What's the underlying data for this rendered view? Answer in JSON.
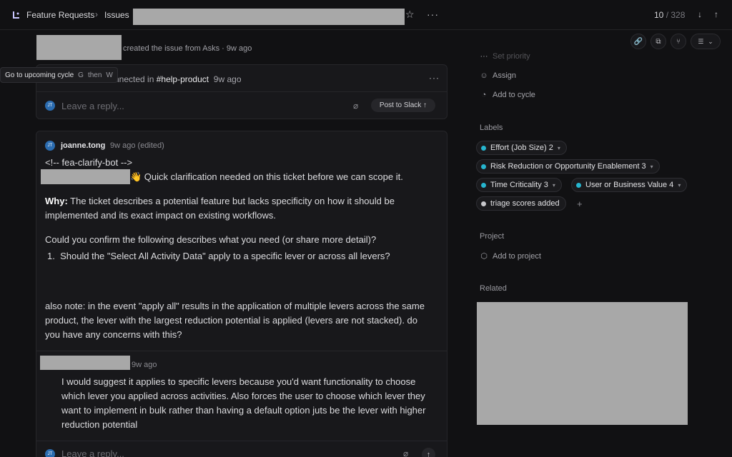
{
  "header": {
    "breadcrumb": [
      "Feature Requests",
      "Issues"
    ],
    "counter_current": "10",
    "counter_total": "/ 328"
  },
  "activity": {
    "created_text": "created the issue from Asks · 9w ago"
  },
  "tooltip": {
    "label": "Go to upcoming cycle",
    "key1": "G",
    "then": "then",
    "key2": "W"
  },
  "slack_thread": {
    "prefix": "nnected in",
    "channel": "#help-product",
    "time": "9w ago",
    "reply_placeholder": "Leave a reply...",
    "post_button": "Post to Slack"
  },
  "comment": {
    "avatar": "JT",
    "author": "joanne.tong",
    "meta": "9w ago (edited)",
    "line1": "<!-- fea-clarify-bot -->",
    "line2": "👋 Quick clarification needed on this ticket before we can scope it.",
    "why_label": "Why:",
    "why_text1": " The ticket describes a potential feature but lacks specificity on how it should be",
    "why_text2": "implemented and its exact impact on existing workflows.",
    "confirm": "Could you confirm the following describes what you need (or share more detail)?",
    "list_number": "1.",
    "list_item": "Should the \"Select All Activity Data\" apply to a specific lever or across all levers?",
    "note1": "also note: in the event \"apply all\" results in the application of multiple levers across the same",
    "note2": "product, the lever with the largest reduction potential is applied (levers are not stacked). do",
    "note3": "you have any concerns with this?"
  },
  "reply": {
    "time": "9w ago",
    "line1": "I would suggest it applies to specific levers because you'd want functionality to choose",
    "line2": "which lever you applied across activities. Also forces the user to choose which lever they",
    "line3": "want to implement in bulk rather than having a default option juts be the lever with higher",
    "line4": "reduction potential",
    "placeholder": "Leave a reply..."
  },
  "sidebar": {
    "set_priority": "Set priority",
    "assign": "Assign",
    "add_cycle": "Add to cycle",
    "labels_title": "Labels",
    "labels": [
      {
        "text": "Effort (Job Size) 2",
        "color": "#26b5ce"
      },
      {
        "text": "Risk Reduction or Opportunity Enablement 3",
        "color": "#26b5ce"
      },
      {
        "text": "Time Criticality 3",
        "color": "#26b5ce"
      },
      {
        "text": "User or Business Value 4",
        "color": "#26b5ce"
      },
      {
        "text": "triage scores added",
        "color": "#c8c8cc"
      }
    ],
    "project_title": "Project",
    "add_project": "Add to project",
    "related_title": "Related"
  }
}
